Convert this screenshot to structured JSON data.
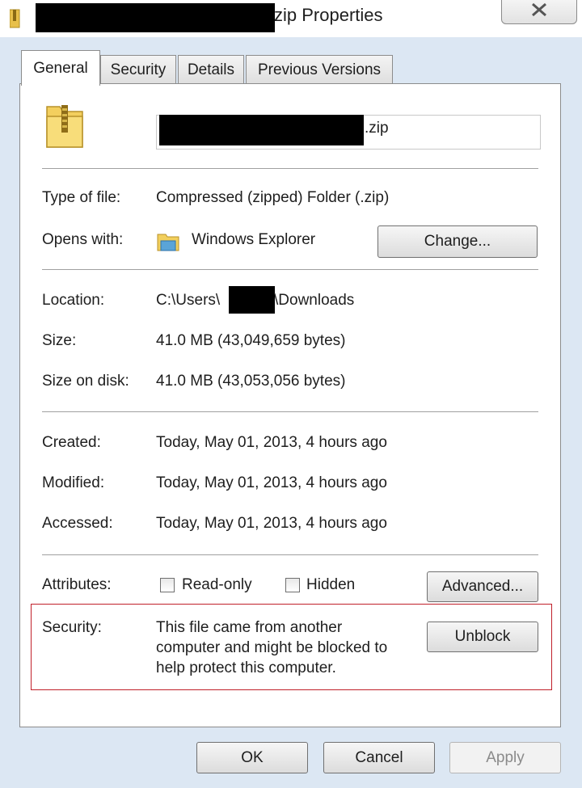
{
  "window": {
    "title_suffix": "zip Properties",
    "close_icon": "close-icon"
  },
  "tabs": [
    {
      "label": "General",
      "active": true
    },
    {
      "label": "Security",
      "active": false
    },
    {
      "label": "Details",
      "active": false
    },
    {
      "label": "Previous Versions",
      "active": false
    }
  ],
  "file": {
    "name_suffix": ".zip",
    "icon": "zip-folder-icon"
  },
  "info": {
    "type_label": "Type of file:",
    "type_value": "Compressed (zipped) Folder (.zip)",
    "opens_label": "Opens with:",
    "opens_value": "Windows Explorer",
    "opens_icon": "windows-explorer-icon",
    "change_button": "Change...",
    "location_label": "Location:",
    "location_prefix": "C:\\Users\\",
    "location_suffix": "\\Downloads",
    "size_label": "Size:",
    "size_value": "41.0 MB (43,049,659 bytes)",
    "size_disk_label": "Size on disk:",
    "size_disk_value": "41.0 MB (43,053,056 bytes)",
    "created_label": "Created:",
    "created_value": "Today, May 01, 2013, 4 hours ago",
    "modified_label": "Modified:",
    "modified_value": "Today, May 01, 2013, 4 hours ago",
    "accessed_label": "Accessed:",
    "accessed_value": "Today, May 01, 2013, 4 hours ago"
  },
  "attributes": {
    "label": "Attributes:",
    "readonly_label": "Read-only",
    "readonly_checked": false,
    "hidden_label": "Hidden",
    "hidden_checked": false,
    "advanced_button": "Advanced..."
  },
  "security": {
    "label": "Security:",
    "line1": "This file came from another",
    "line2": "computer and might be blocked to",
    "line3": "help protect this computer.",
    "unblock_button": "Unblock",
    "highlight_color": "#c0202a"
  },
  "footer": {
    "ok": "OK",
    "cancel": "Cancel",
    "apply": "Apply"
  }
}
